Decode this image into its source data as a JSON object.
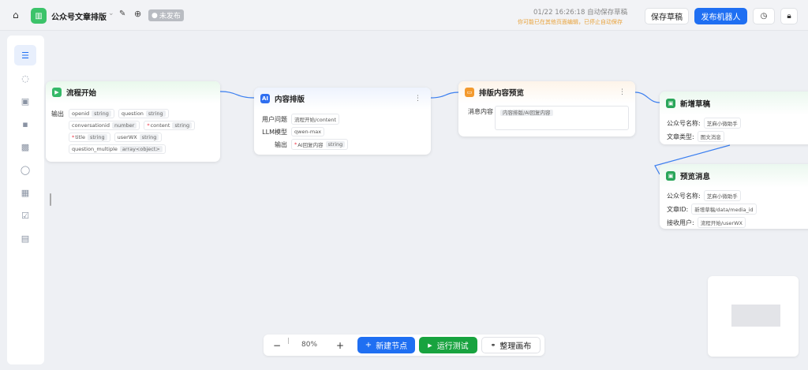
{
  "header": {
    "title": "公众号文章排版",
    "status": "未发布",
    "save_time": "01/22 16:26:18 自动保存草稿",
    "warning": "你可能已在其他页面编辑，已停止自动保存",
    "save_draft": "保存草稿",
    "publish": "发布机器人",
    "accent": "#1f6ff2",
    "warning_color": "#e8a23a"
  },
  "sidebar": {
    "items": [
      "database-icon",
      "chat-icon",
      "video-icon",
      "alert-icon",
      "image-icon",
      "message-icon",
      "chart-icon",
      "edit-icon",
      "document-icon"
    ]
  },
  "nodes": {
    "start": {
      "title": "流程开始",
      "output_label": "输出",
      "fields": [
        {
          "name": "openid",
          "type": "string",
          "required": false
        },
        {
          "name": "question",
          "type": "string",
          "required": false
        },
        {
          "name": "conversationid",
          "type": "number",
          "required": false
        },
        {
          "name": "content",
          "type": "string",
          "required": true
        },
        {
          "name": "title",
          "type": "string",
          "required": true
        },
        {
          "name": "userWX",
          "type": "string",
          "required": false
        },
        {
          "name": "question_multiple",
          "type": "array<object>",
          "required": false
        }
      ]
    },
    "ai": {
      "title": "内容排版",
      "rows": [
        {
          "label": "用户问题",
          "value": "流程开始/content"
        },
        {
          "label": "LLM模型",
          "value": "qwen-max"
        }
      ],
      "output_label": "输出",
      "output": {
        "name": "AI回复内容",
        "type": "string"
      }
    },
    "preview": {
      "title": "排版内容预览",
      "label": "消息内容",
      "value": "内容排版/AI回复内容"
    },
    "draft": {
      "title": "新增草稿",
      "rows": [
        {
          "label": "公众号名称:",
          "value": "芝麻小微助手"
        },
        {
          "label": "文章类型:",
          "value": "图文消息"
        }
      ]
    },
    "msg": {
      "title": "预览消息",
      "rows": [
        {
          "label": "公众号名称:",
          "value": "芝麻小微助手"
        },
        {
          "label": "文章ID:",
          "value": "新增草稿/data/media_id"
        },
        {
          "label": "接收用户:",
          "value": "流程开始/userWX"
        }
      ]
    }
  },
  "toolbar": {
    "zoom": "80%",
    "new_node": "新建节点",
    "run_test": "运行测试",
    "tidy": "整理画布"
  }
}
